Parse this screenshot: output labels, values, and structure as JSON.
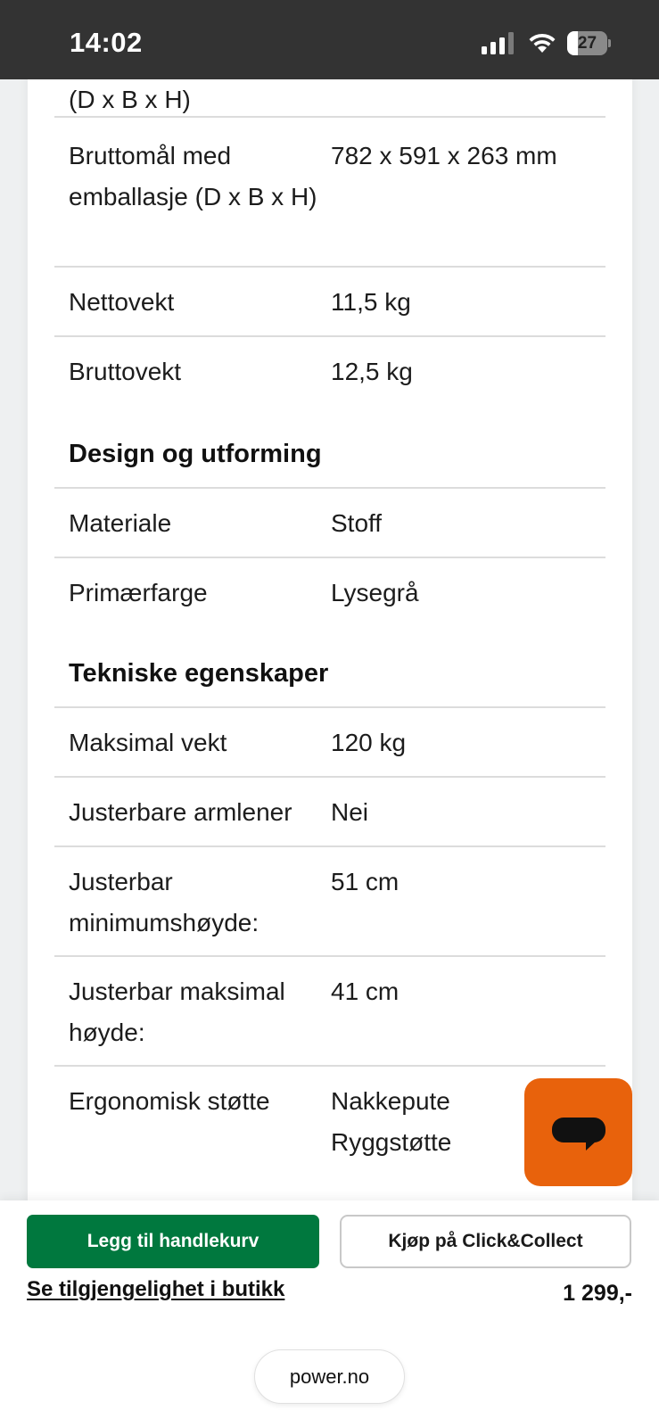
{
  "status_bar": {
    "time": "14:02",
    "battery_level": "27",
    "battery_fraction": 0.27,
    "icons": [
      "signal-icon",
      "wifi-icon",
      "battery-icon"
    ]
  },
  "specs": {
    "cut_off_text": "(D x B x H)",
    "rows_dimensions": [
      {
        "label": "Bruttomål med emballasje (D x B x H)",
        "value": "782 x 591 x 263 mm"
      },
      {
        "label": "Nettovekt",
        "value": "11,5 kg"
      },
      {
        "label": "Bruttovekt",
        "value": "12,5 kg"
      }
    ],
    "design_heading": "Design og utforming",
    "rows_design": [
      {
        "label": "Materiale",
        "value": "Stoff"
      },
      {
        "label": "Primærfarge",
        "value": "Lysegrå"
      }
    ],
    "technical_heading": "Tekniske egenskaper",
    "rows_technical": [
      {
        "label": "Maksimal vekt",
        "value": "120 kg"
      },
      {
        "label": "Justerbare armlener",
        "value": "Nei"
      },
      {
        "label": "Justerbar minimumshøyde:",
        "value": "51 cm"
      },
      {
        "label": "Justerbar maksimal høyde:",
        "value": "41 cm"
      },
      {
        "label": "Ergonomisk støtte",
        "value": "Nakkepute Ryggstøtte"
      }
    ]
  },
  "chat": {
    "icon": "chat-bubble-icon",
    "color": "#e8620c"
  },
  "bottom_bar": {
    "add_to_cart_label": "Legg til handlekurv",
    "click_collect_label": "Kjøp på Click&Collect",
    "availability_link": "Se tilgjengelighet i butikk",
    "price": "1 299,-",
    "url": "power.no"
  },
  "colors": {
    "primary_green": "#00783e",
    "accent_orange": "#e8620c",
    "status_bar_bg": "#333333"
  }
}
